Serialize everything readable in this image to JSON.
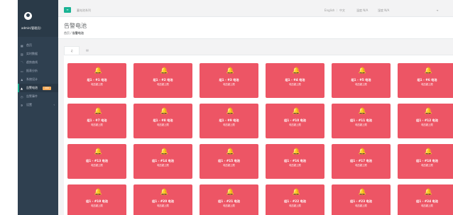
{
  "sidebar": {
    "user": "admin(管理员)",
    "items": [
      {
        "icon": "home-icon",
        "glyph": "▦",
        "label": "首页"
      },
      {
        "icon": "bar-chart-icon",
        "glyph": "▥",
        "label": "实时数据"
      },
      {
        "icon": "line-chart-icon",
        "glyph": "〽",
        "label": "趋势曲线"
      },
      {
        "icon": "monitor-icon",
        "glyph": "▭",
        "label": "报表分析"
      },
      {
        "icon": "user-icon",
        "glyph": "♟",
        "label": "系统设计"
      },
      {
        "icon": "warning-icon",
        "glyph": "▲",
        "label": "告警电池",
        "badge": "200",
        "active": true
      },
      {
        "icon": "clock-icon",
        "glyph": "◷",
        "label": "告警事件"
      },
      {
        "icon": "settings-icon",
        "glyph": "✲",
        "label": "设置",
        "arrow": "‹"
      }
    ]
  },
  "topbar": {
    "menu_icon": "menu-icon",
    "title": "蓄电池系列",
    "lang": "English ｜ 中文",
    "stat1": "温度 N/A",
    "stat2": "湿度 N/A",
    "logout": "⇥"
  },
  "heading": {
    "title": "告警电池",
    "crumb_home": "首页",
    "crumb_sep": "/",
    "crumb_current": "告警电池"
  },
  "tabs": [
    {
      "icon": "bell-icon",
      "glyph": "♫"
    },
    {
      "icon": "list-icon",
      "glyph": "▤"
    }
  ],
  "colors": {
    "alarm": "#ed5565",
    "sidebar": "#2f4050",
    "accent": "#1ab394"
  },
  "cells": [
    {
      "name": "组1 - #1 电池",
      "status": "电压超上限"
    },
    {
      "name": "组1 - #2 电池",
      "status": "电压超上限"
    },
    {
      "name": "组1 - #3 电池",
      "status": "电压超上限"
    },
    {
      "name": "组1 - #4 电池",
      "status": "电压超上限"
    },
    {
      "name": "组1 - #5 电池",
      "status": "电压超上限"
    },
    {
      "name": "组1 - #6 电池",
      "status": "电压超上限"
    },
    {
      "name": "组1 - #7 电池",
      "status": "电压超上限"
    },
    {
      "name": "组1 - #8 电池",
      "status": "电压超上限"
    },
    {
      "name": "组1 - #9 电池",
      "status": "电压超上限"
    },
    {
      "name": "组1 - #10 电池",
      "status": "电压超上限"
    },
    {
      "name": "组1 - #11 电池",
      "status": "电压超上限"
    },
    {
      "name": "组1 - #12 电池",
      "status": "电压超上限"
    },
    {
      "name": "组1 - #13 电池",
      "status": "电压超上限"
    },
    {
      "name": "组1 - #14 电池",
      "status": "电压超上限"
    },
    {
      "name": "组1 - #15 电池",
      "status": "电压超上限"
    },
    {
      "name": "组1 - #16 电池",
      "status": "电压超上限"
    },
    {
      "name": "组1 - #17 电池",
      "status": "电压超上限"
    },
    {
      "name": "组1 - #18 电池",
      "status": "电压超上限"
    },
    {
      "name": "组1 - #19 电池",
      "status": "电压超上限"
    },
    {
      "name": "组1 - #20 电池",
      "status": "电压超上限"
    },
    {
      "name": "组1 - #21 电池",
      "status": "电压超上限"
    },
    {
      "name": "组1 - #22 电池",
      "status": "电压超上限"
    },
    {
      "name": "组1 - #23 电池",
      "status": "电压超上限"
    },
    {
      "name": "组1 - #24 电池",
      "status": "电压超上限"
    }
  ]
}
